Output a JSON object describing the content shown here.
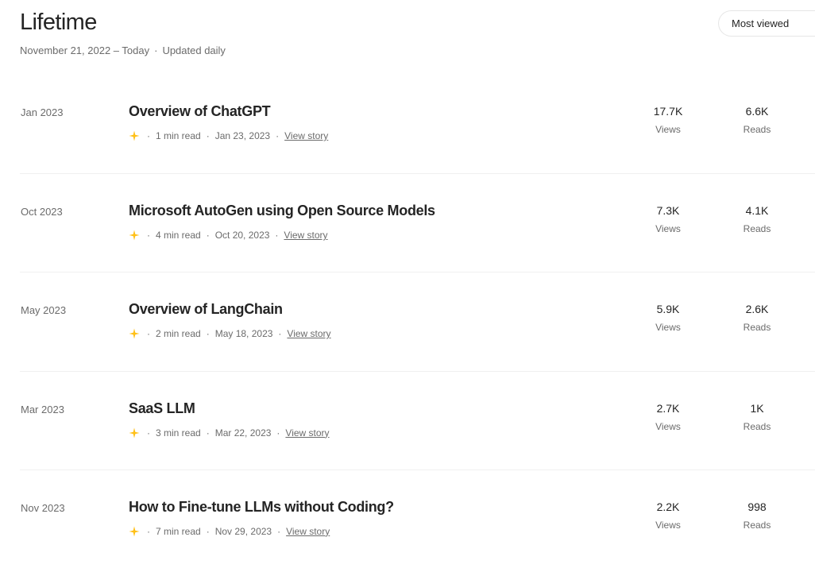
{
  "header": {
    "title": "Lifetime",
    "date_range": "November 21, 2022 – Today",
    "separator": "·",
    "update_note": "Updated daily",
    "sort_selected": "Most viewed"
  },
  "stories": [
    {
      "month": "Jan 2023",
      "title": "Overview of ChatGPT",
      "read_time": "1 min read",
      "date": "Jan 23, 2023",
      "link_label": "View story",
      "views": "17.7K",
      "views_label": "Views",
      "reads": "6.6K",
      "reads_label": "Reads"
    },
    {
      "month": "Oct 2023",
      "title": "Microsoft AutoGen using Open Source Models",
      "read_time": "4 min read",
      "date": "Oct 20, 2023",
      "link_label": "View story",
      "views": "7.3K",
      "views_label": "Views",
      "reads": "4.1K",
      "reads_label": "Reads"
    },
    {
      "month": "May 2023",
      "title": "Overview of LangChain",
      "read_time": "2 min read",
      "date": "May 18, 2023",
      "link_label": "View story",
      "views": "5.9K",
      "views_label": "Views",
      "reads": "2.6K",
      "reads_label": "Reads"
    },
    {
      "month": "Mar 2023",
      "title": "SaaS LLM",
      "read_time": "3 min read",
      "date": "Mar 22, 2023",
      "link_label": "View story",
      "views": "2.7K",
      "views_label": "Views",
      "reads": "1K",
      "reads_label": "Reads"
    },
    {
      "month": "Nov 2023",
      "title": "How to Fine-tune LLMs without Coding?",
      "read_time": "7 min read",
      "date": "Nov 29, 2023",
      "link_label": "View story",
      "views": "2.2K",
      "views_label": "Views",
      "reads": "998",
      "reads_label": "Reads"
    }
  ],
  "icons": {
    "member_story": "star-icon"
  },
  "colors": {
    "star": "#FFC017",
    "text_primary": "#242424",
    "text_secondary": "#6b6b6b",
    "divider": "#f0f0f0"
  }
}
